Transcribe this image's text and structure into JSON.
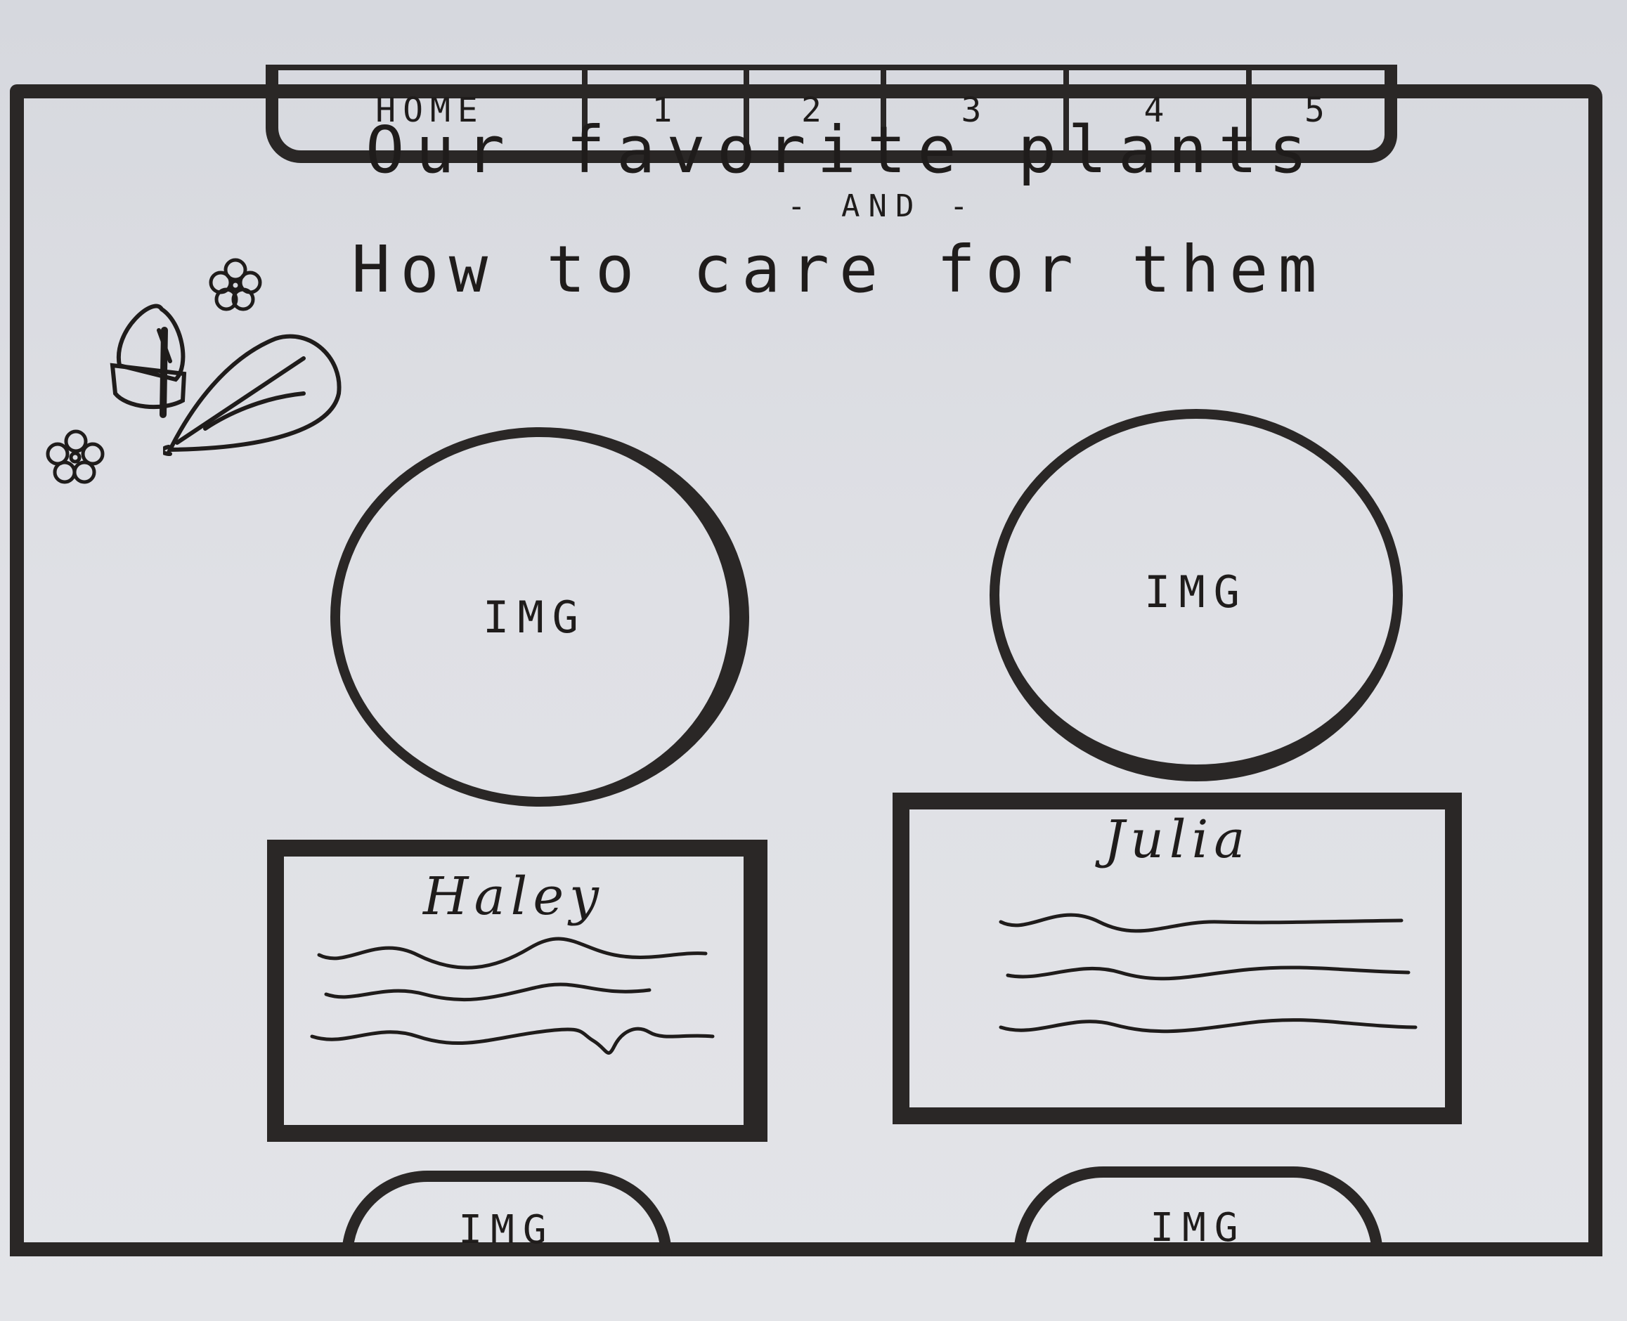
{
  "nav": {
    "items": [
      {
        "label": "HOME"
      },
      {
        "label": "1"
      },
      {
        "label": "2"
      },
      {
        "label": "3"
      },
      {
        "label": "4"
      },
      {
        "label": "5"
      }
    ]
  },
  "header": {
    "title": "Our favorite plants",
    "and": "- AND -",
    "subtitle": "How to care for them"
  },
  "profiles": [
    {
      "image_label": "IMG",
      "name": "Haley"
    },
    {
      "image_label": "IMG",
      "name": "Julia"
    }
  ],
  "bottom_images": [
    {
      "label": "IMG"
    },
    {
      "label": "IMG"
    }
  ],
  "icons": [
    "flower-icon",
    "watering-can-icon",
    "leaf-icon",
    "flower-icon"
  ],
  "colors": {
    "ink": "#2a2726",
    "paper": "#dfe0e5"
  }
}
